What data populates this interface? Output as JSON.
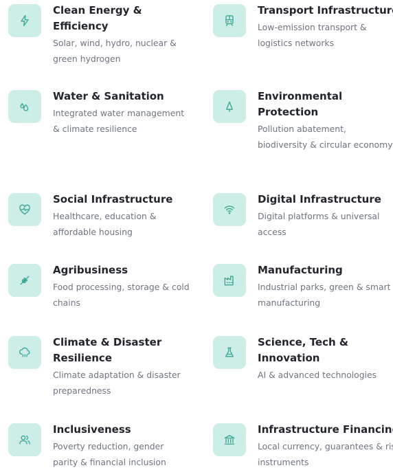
{
  "sectors": [
    {
      "title": "Clean Energy & Efficiency",
      "desc": "Solar, wind, hydro, nuclear & green hydrogen",
      "icon": "lightning-icon"
    },
    {
      "title": "Transport Infrastructure",
      "desc": "Low-emission transport & logistics networks",
      "icon": "train-icon"
    },
    {
      "title": "Water & Sanitation",
      "desc": "Integrated water management & climate resilience",
      "icon": "droplets-icon"
    },
    {
      "title": "Environmental Protection",
      "desc": "Pollution abatement, biodiversity & circular economy",
      "icon": "tree-icon"
    },
    {
      "title": "Social Infrastructure",
      "desc": "Healthcare, education & affordable housing",
      "icon": "heart-pulse-icon"
    },
    {
      "title": "Digital Infrastructure",
      "desc": "Digital platforms & universal access",
      "icon": "wifi-icon"
    },
    {
      "title": "Agribusiness",
      "desc": "Food processing, storage & cold chains",
      "icon": "wheat-icon"
    },
    {
      "title": "Manufacturing",
      "desc": "Industrial parks, green & smart manufacturing",
      "icon": "factory-icon"
    },
    {
      "title": "Climate & Disaster Resilience",
      "desc": "Climate adaptation & disaster preparedness",
      "icon": "cloud-rain-icon"
    },
    {
      "title": "Science, Tech & Innovation",
      "desc": "AI & advanced technologies",
      "icon": "flask-icon"
    },
    {
      "title": "Inclusiveness",
      "desc": "Poverty reduction, gender parity & financial inclusion",
      "icon": "users-icon"
    },
    {
      "title": "Infrastructure Financing",
      "desc": "Local currency, guarantees & risk instruments",
      "icon": "bank-icon"
    }
  ],
  "colors": {
    "icon_bg": "#cdeee6",
    "icon_stroke": "#3aa58f",
    "title": "#22252b",
    "desc": "#6f7480"
  }
}
